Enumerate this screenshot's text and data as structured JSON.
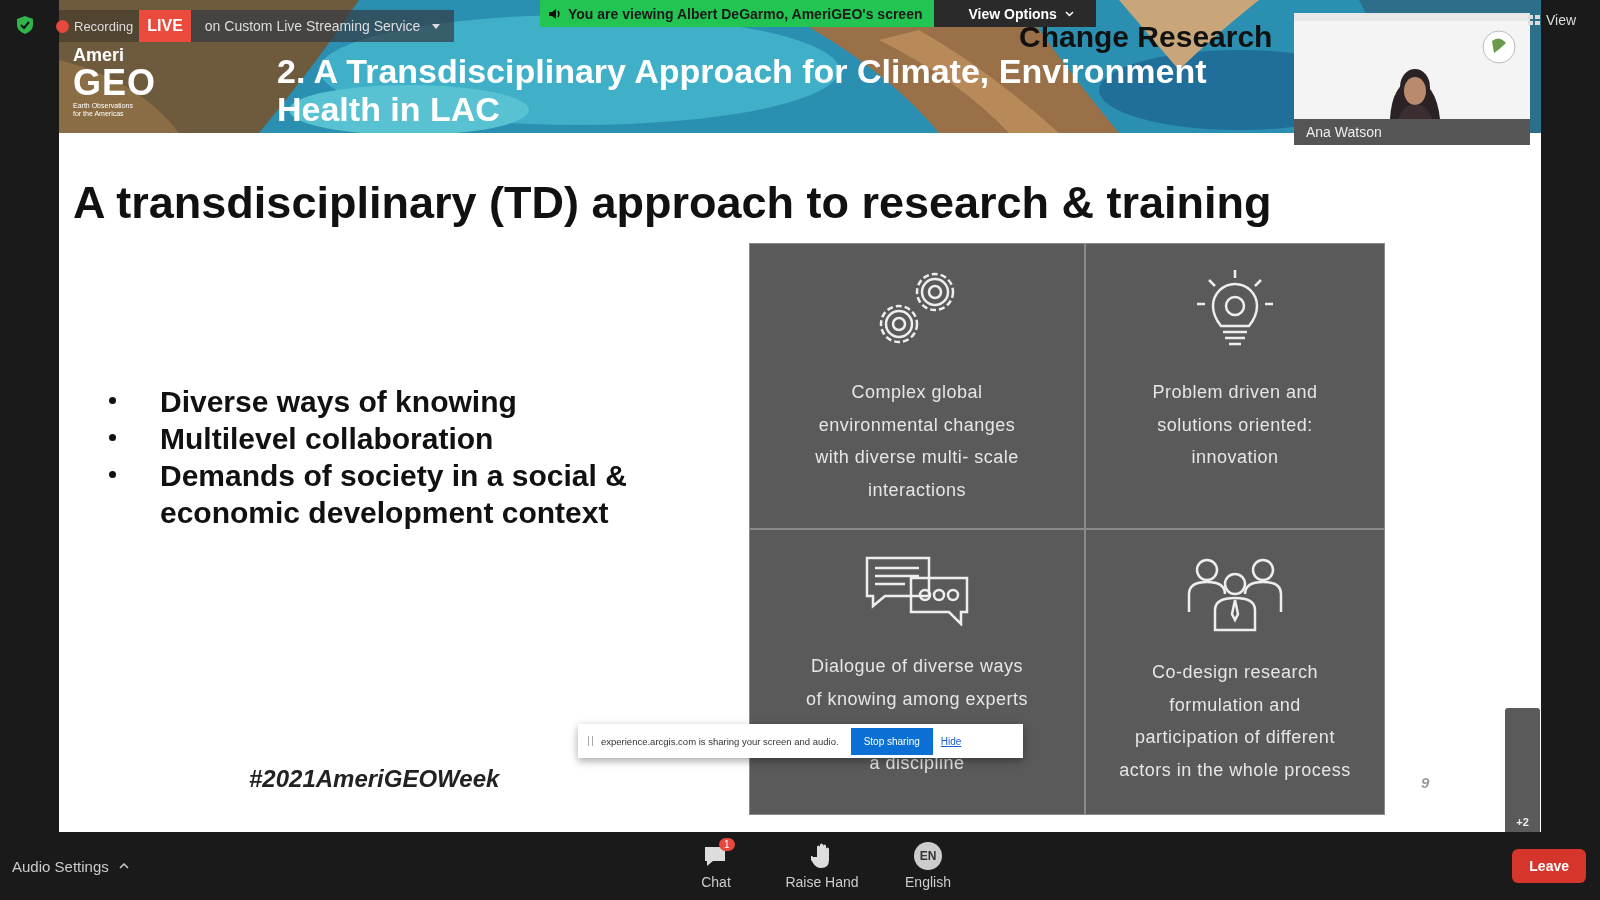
{
  "meeting_status": {
    "recording": "Recording",
    "live": "LIVE",
    "stream": "on Custom Live Streaming Service"
  },
  "share_banner": {
    "text": "You are viewing Albert DeGarmo, AmeriGEO's screen",
    "view_options": "View Options"
  },
  "view_button": "View",
  "video_tile": {
    "name": "Ana Watson"
  },
  "slide": {
    "header": {
      "logo_top": "Ameri",
      "logo_main": "GEO",
      "logo_tagline": "Earth Observations for the Americas",
      "org": "Change Research",
      "title_lines": [
        "2. A Transdisciplinary Approach for Climate, Environment",
        "Health in LAC"
      ]
    },
    "title": "A transdisciplinary (TD) approach to research & training",
    "bullets": [
      "Diverse ways of knowing",
      "Multilevel collaboration",
      "Demands of society in a social & economic development context"
    ],
    "grid": [
      {
        "kind": "gears",
        "text": "Complex global environmental changes with diverse multi- scale interactions"
      },
      {
        "kind": "bulb",
        "text": "Problem driven and solutions oriented: innovation"
      },
      {
        "kind": "dialogue",
        "text": "Dialogue of diverse ways of knowing among experts",
        "text_end": "a discipline"
      },
      {
        "kind": "people",
        "text": "Co-design research formulation and participation of different actors in the whole process"
      }
    ],
    "hashtag": "#2021AmeriGEOWeek",
    "page_number": "9"
  },
  "browser_notice": {
    "text": "experience.arcgis.com is sharing your screen and audio.",
    "stop": "Stop sharing",
    "hide": "Hide"
  },
  "gallery_more": "+2",
  "toolbar": {
    "audio": "Audio Settings",
    "items": [
      {
        "kind": "chat",
        "label": "Chat",
        "badge": "1"
      },
      {
        "kind": "hand",
        "label": "Raise Hand"
      },
      {
        "kind": "language",
        "label": "English",
        "icon_text": "EN"
      }
    ],
    "leave": "Leave"
  }
}
